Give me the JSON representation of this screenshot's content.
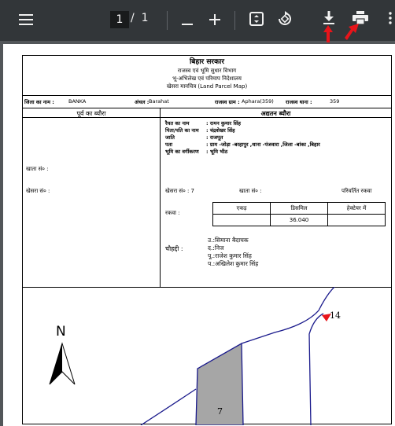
{
  "toolbar": {
    "page_current": "1",
    "page_separator": "/",
    "page_total": "1",
    "icons": [
      "menu-icon",
      "minus-icon",
      "plus-icon",
      "fit-page-icon",
      "rotate-icon",
      "download-icon",
      "print-icon",
      "more-icon"
    ]
  },
  "colors": {
    "toolbar": "#323639",
    "viewer_bg": "#525659",
    "annotation_arrow": "#e8141a",
    "map_line": "#1a1a8c",
    "parcel_fill": "#a6a6a6"
  },
  "doc": {
    "header": {
      "govt": "बिहार सरकार",
      "dept": "राजस्व एवं भूमि सुधार विभाग",
      "directorate": "भू-अभिलेख एवं परिमाप निदेशालय",
      "map_title": "खेसरा मानचित्र (Land Parcel Map)"
    },
    "info": {
      "district_label": "जिला का नाम :",
      "district_value": "BANKA",
      "circle_label": "अंचल :",
      "circle_value": "Barahat",
      "village_label": "राजस्व ग्राम :",
      "village_value": "Aphara(359)",
      "thana_label": "राजस्व थाना :",
      "thana_value": "359"
    },
    "left": {
      "title": "पूर्व का ब्यौरा",
      "khata_label": "खाता सं० :",
      "khesra_label": "खेसरा सं० :"
    },
    "right": {
      "title": "अद्यतन ब्यौरा",
      "details": [
        {
          "label": "रैयत का नाम",
          "value": ": रामन कुमार सिंह"
        },
        {
          "label": "पिता/पति का नाम",
          "value": ": चंद्रशेखर सिंह"
        },
        {
          "label": "जाति",
          "value": ": राजपूत"
        },
        {
          "label": "पता",
          "value": ": ग्राम -जोड़ा -बरहापुर ,थाना -पंजवारा ,जिला -बांका ,बिहार"
        },
        {
          "label": "भूमि का वर्गीकरण",
          "value": ": भूमि भीठ"
        }
      ],
      "khesra_label": "खेसरा सं० : 7",
      "khata_label": "खाता सं० :",
      "changed_area": "परिवर्तित रकवा",
      "rakwa_label": "रकवा :",
      "area_headers": [
        "एकड़",
        "डिसमिल",
        "हेक्टेयर में"
      ],
      "area_values": [
        "",
        "36.040",
        ""
      ],
      "chauhaddi_label": "चौहद्दी :",
      "chauhaddi": [
        "उ.:सिमाना बैदाचक",
        "द.:निज",
        "पू.:राजेश कुमार सिंह",
        "प.:अखिलेश कुमार सिंह"
      ]
    },
    "map": {
      "north_label": "N",
      "plots": [
        "14",
        "7"
      ]
    }
  }
}
